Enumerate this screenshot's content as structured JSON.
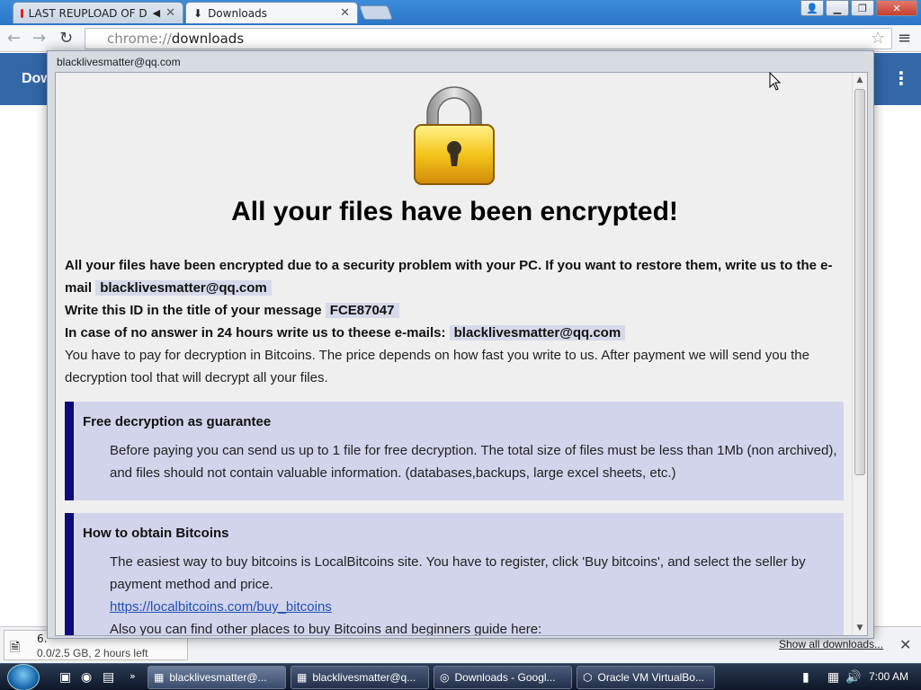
{
  "browser": {
    "tabs": [
      {
        "label": "LAST REUPLOAD OF D",
        "icon": "youtube-icon"
      },
      {
        "label": "Downloads",
        "icon": "download-icon"
      }
    ],
    "url_scheme": "chrome://",
    "url_host": "downloads"
  },
  "downloads_page": {
    "title": "Dow"
  },
  "shelf": {
    "item_name": "6.",
    "item_progress": "0.0/2.5 GB, 2 hours left",
    "show_all": "Show all downloads..."
  },
  "dialog": {
    "title": "blacklivesmatter@qq.com",
    "headline": "All your files have been encrypted!",
    "p1_text": "All your files have been encrypted due to a security problem with your PC. If you want to restore them, write us to the e-mail",
    "email": "blacklivesmatter@qq.com",
    "p2_text": "Write this ID in the title of your message",
    "id": "FCE87047",
    "p3_text": "In case of no answer in 24 hours write us to theese e-mails:",
    "p4_text": "You have to pay for decryption in Bitcoins. The price depends on how fast you write to us. After payment we will send you the decryption tool that will decrypt all your files.",
    "box1": {
      "heading": "Free decryption as guarantee",
      "text": "Before paying you can send us up to 1 file for free decryption. The total size of files must be less than 1Mb (non archived), and files should not contain valuable information. (databases,backups, large excel sheets, etc.)"
    },
    "box2": {
      "heading": "How to obtain Bitcoins",
      "text": "The easiest way to buy bitcoins is LocalBitcoins site. You have to register, click 'Buy bitcoins', and select the seller by payment method and price.",
      "link": "https://localbitcoins.com/buy_bitcoins",
      "text2": "Also you can find other places to buy Bitcoins and beginners guide here:"
    }
  },
  "taskbar": {
    "buttons": [
      {
        "label": "blacklivesmatter@..."
      },
      {
        "label": "blacklivesmatter@q..."
      },
      {
        "label": "Downloads - Googl..."
      },
      {
        "label": "Oracle VM VirtualBo..."
      }
    ],
    "clock": "7:00 AM"
  }
}
